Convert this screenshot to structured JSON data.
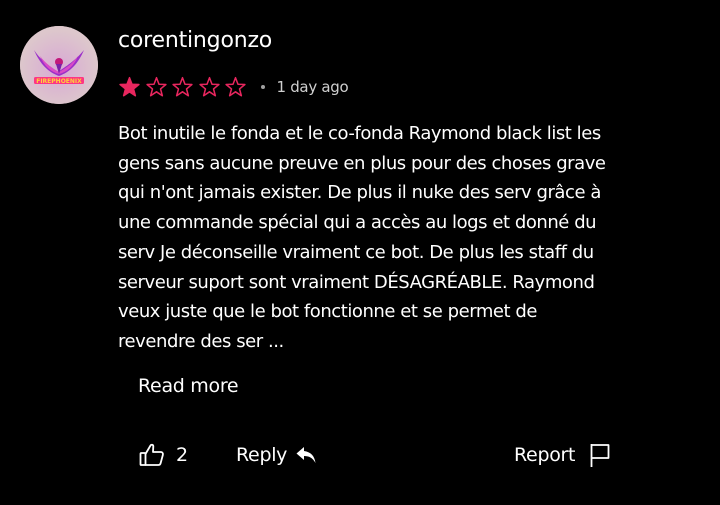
{
  "review": {
    "username": "corentingonzo",
    "avatar_label": "FIREPHOENIX",
    "rating": 1,
    "rating_max": 5,
    "star_color": "#e8265e",
    "time": "1 day ago",
    "text": "Bot inutile le fonda et le co-fonda Raymond black list les\ngens sans aucune preuve en plus pour des choses grave\nqui n'ont jamais exister. De plus il nuke des serv grâce à\nune commande spécial qui a accès au logs et donné du\nserv Je déconseille vraiment ce bot. De plus les staff du\nserveur suport sont vraiment DÉSAGRÉABLE. Raymond\nveux juste que le bot fonctionne et se permet de\nrevendre des ser ...",
    "read_more_label": "Read more"
  },
  "actions": {
    "like_icon": "thumbs-up-icon",
    "like_count": "2",
    "reply_label": "Reply",
    "reply_icon": "reply-arrow-icon",
    "report_label": "Report",
    "report_icon": "flag-icon"
  }
}
